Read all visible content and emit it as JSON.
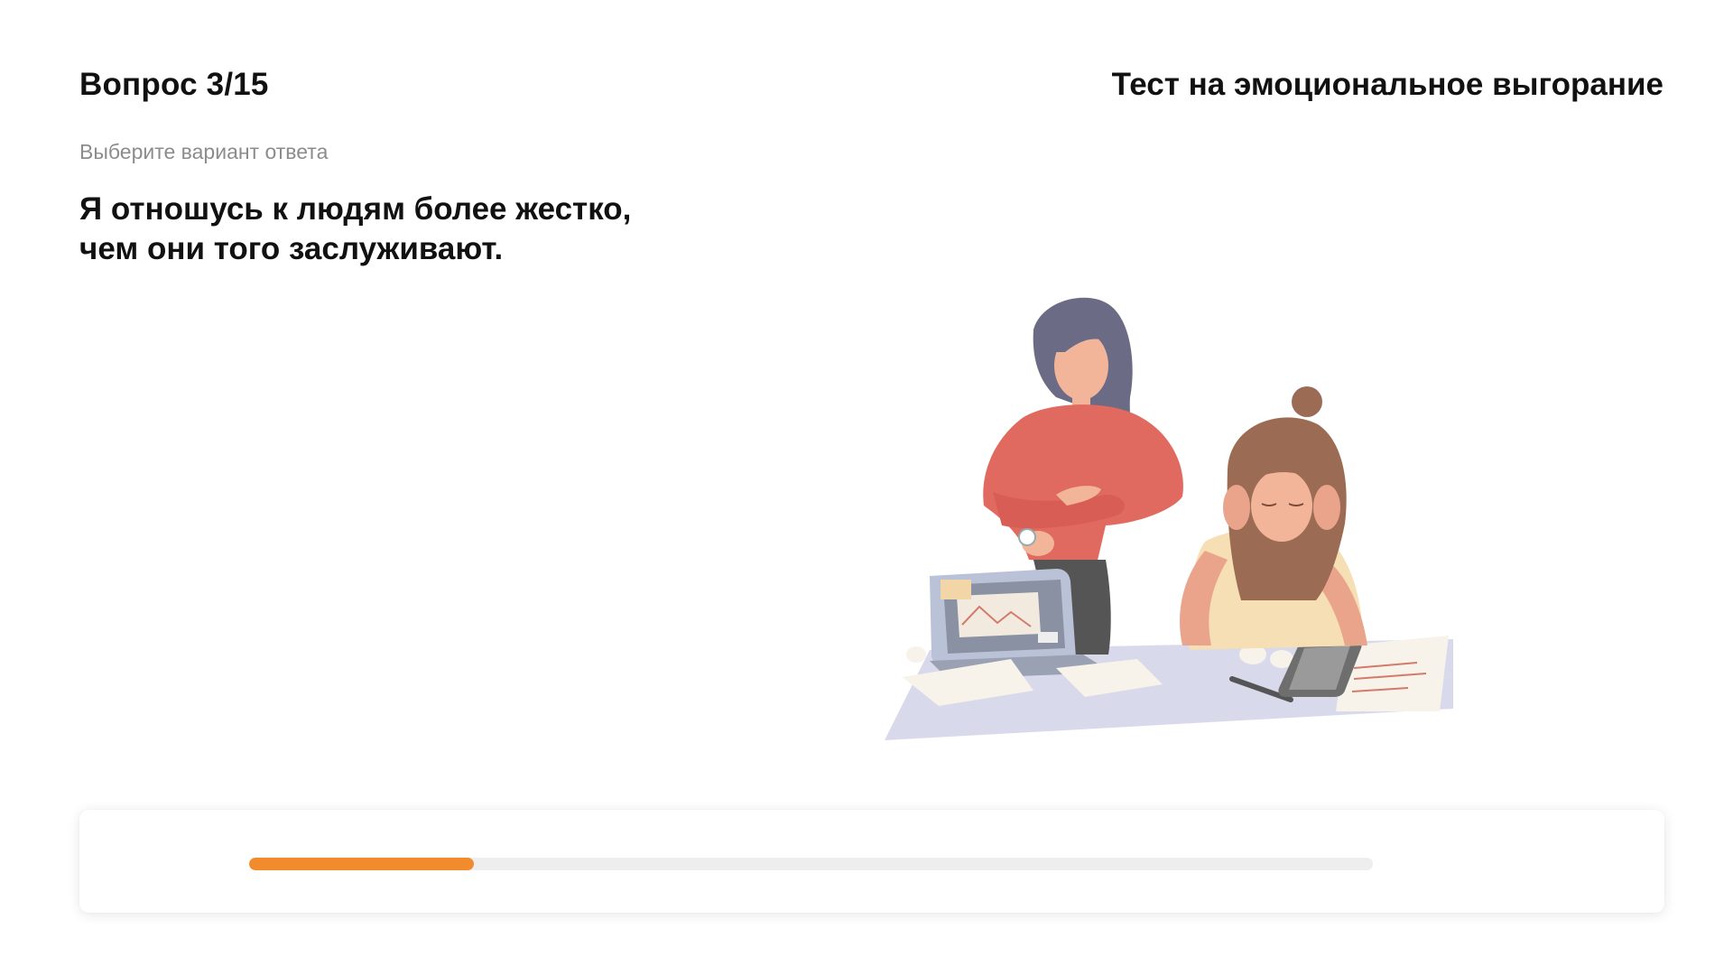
{
  "header": {
    "question_counter": "Вопрос 3/15",
    "test_title": "Тест на эмоциональное выгорание"
  },
  "question": {
    "hint": "Выберите вариант ответа",
    "text_line1": "Я отношусь к людям более жестко,",
    "text_line2": "чем они того заслуживают."
  },
  "illustration": {
    "name": "stressed-office-workers-illustration"
  },
  "progress": {
    "value_fraction": 0.2,
    "color": "#f28b2c",
    "track_color": "#eeeeee"
  }
}
